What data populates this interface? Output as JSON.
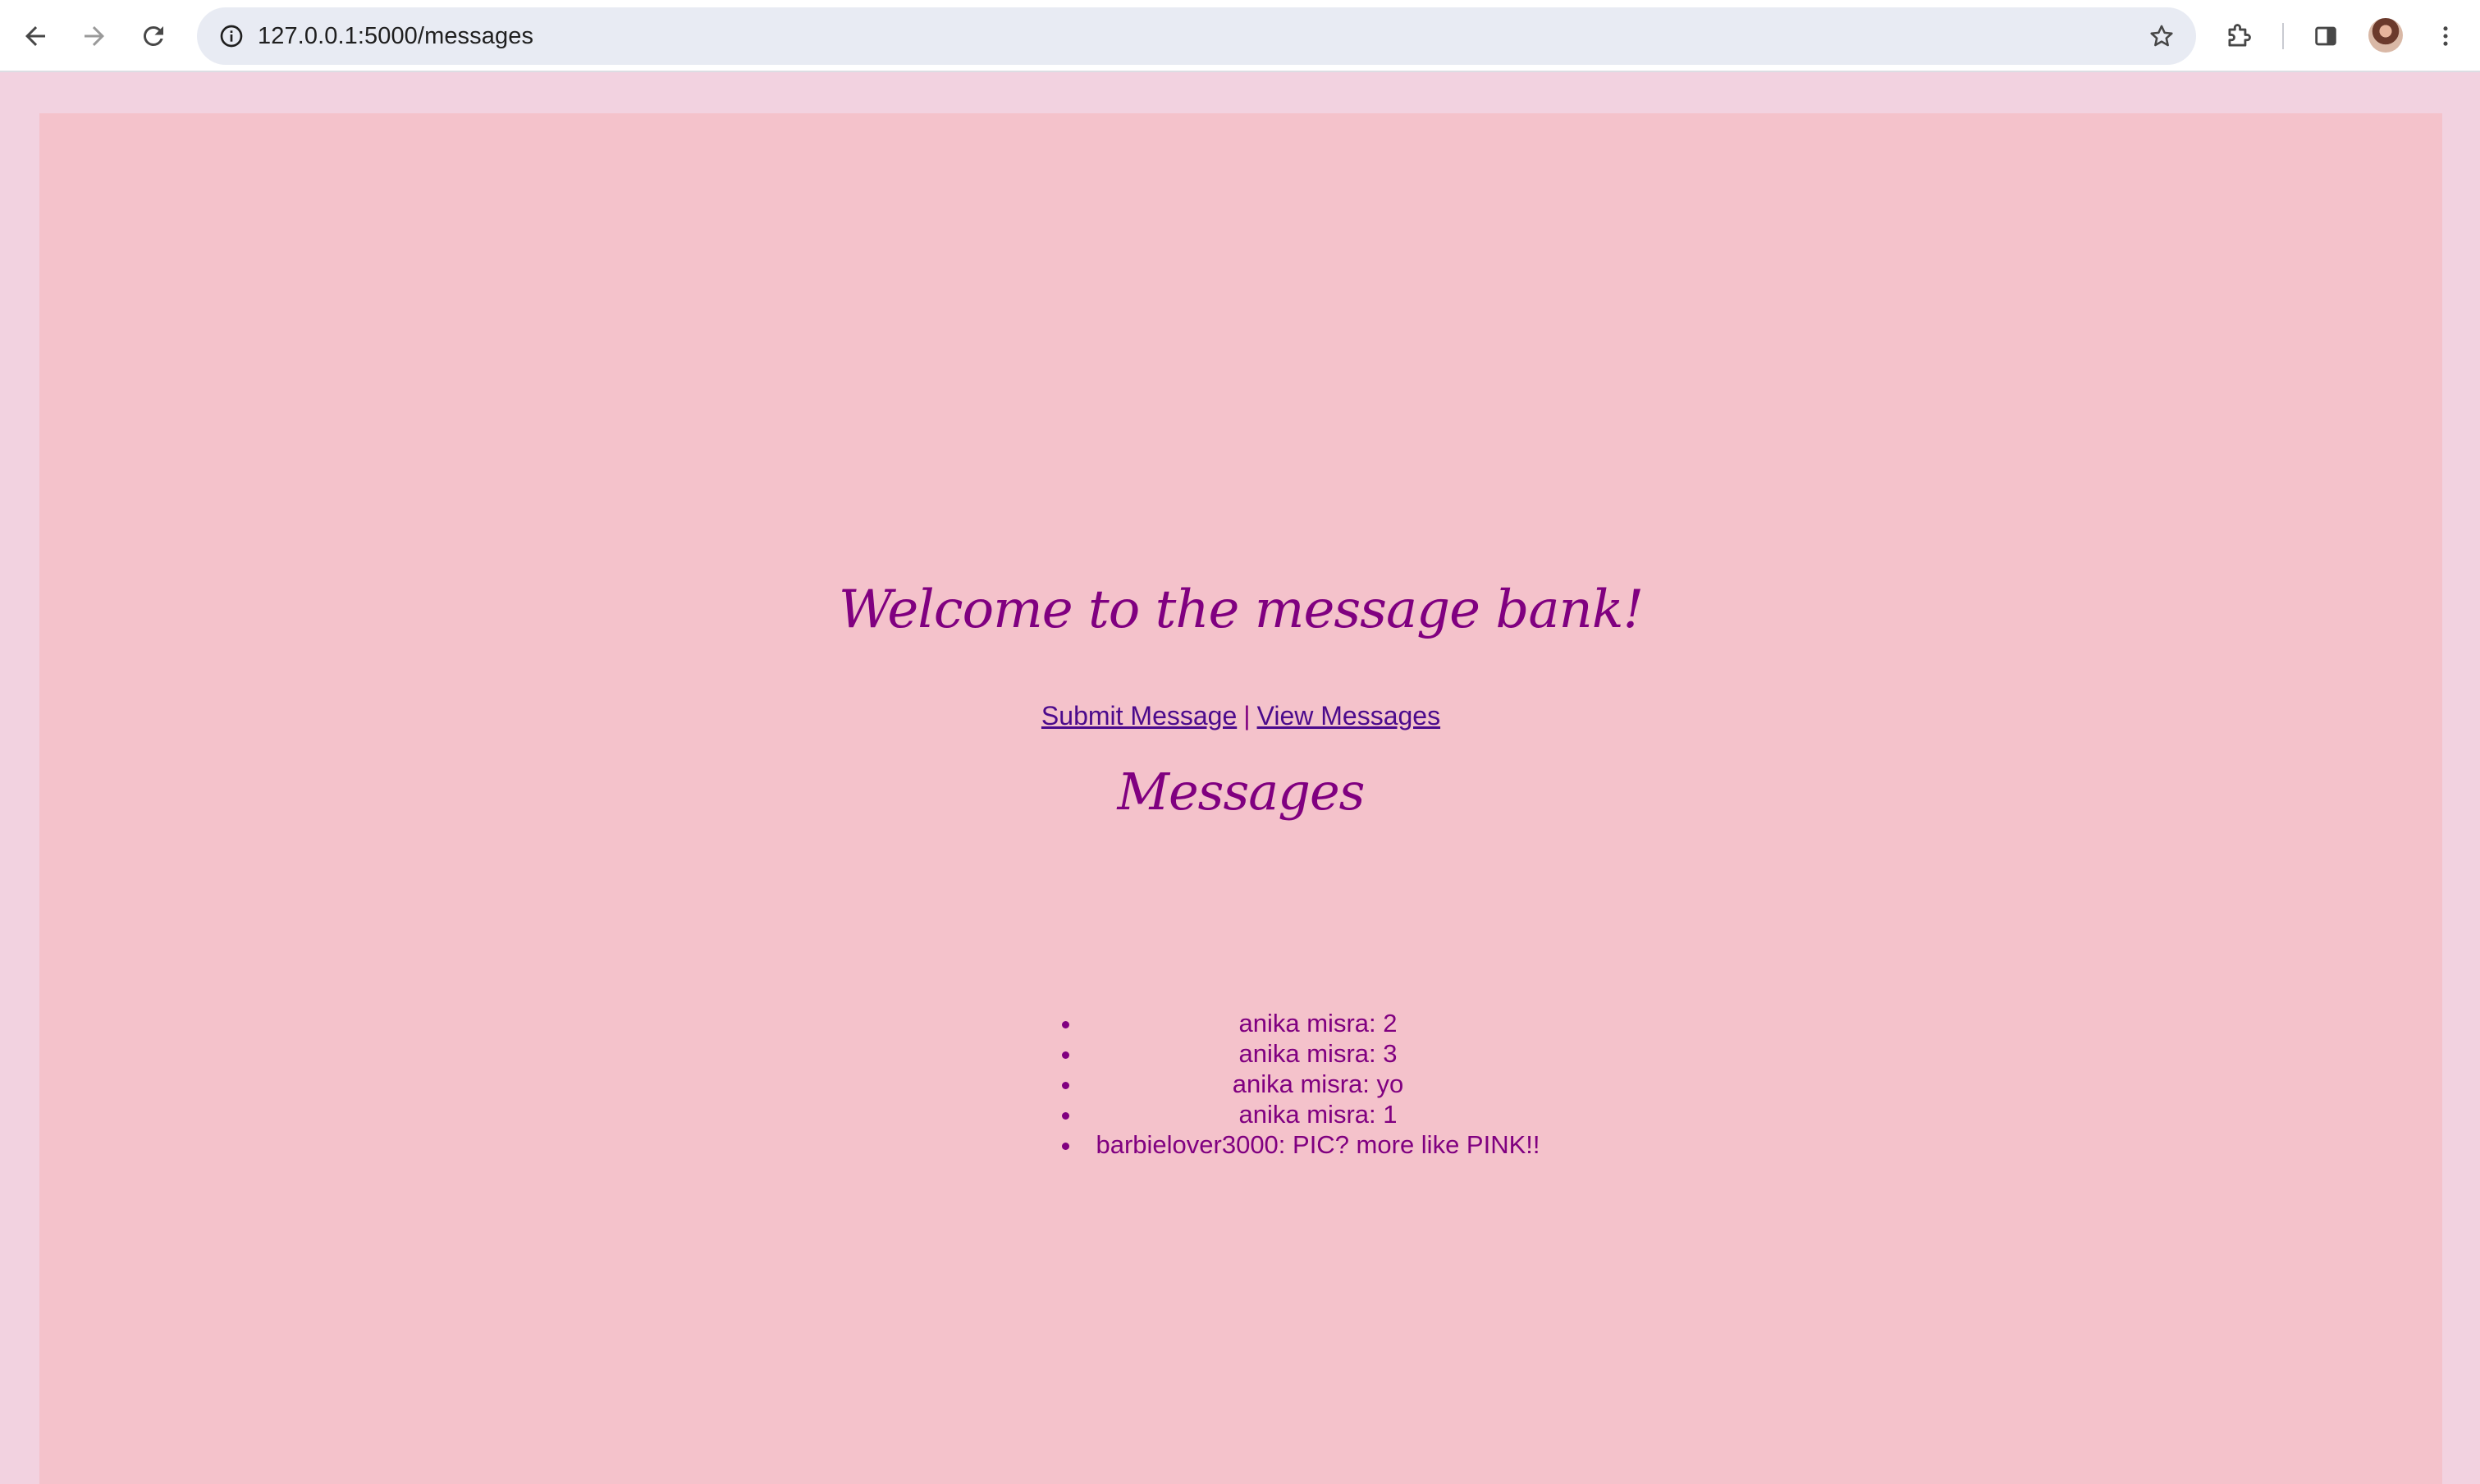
{
  "browser": {
    "url": "127.0.0.1:5000/messages"
  },
  "page": {
    "welcome_title": "Welcome to the message bank!",
    "nav": {
      "submit_label": "Submit Message",
      "separator": "|",
      "view_label": "View Messages"
    },
    "messages_heading": "Messages",
    "messages": [
      "anika misra: 2",
      "anika misra: 3",
      "anika misra: yo",
      "anika misra: 1",
      "barbielover3000: PIC? more like PINK!!"
    ]
  },
  "colors": {
    "page_background": "#f2d2e0",
    "frame_background": "#f4c2cb",
    "text_purple": "#800080",
    "link_purple": "#4b0a8c"
  },
  "icons": {
    "back": "arrow-left-icon",
    "forward": "arrow-right-icon",
    "reload": "reload-icon",
    "site_info": "info-icon",
    "bookmark": "star-icon",
    "extensions": "puzzle-icon",
    "side_panel": "side-panel-icon",
    "profile": "avatar",
    "menu": "kebab-menu-icon"
  }
}
